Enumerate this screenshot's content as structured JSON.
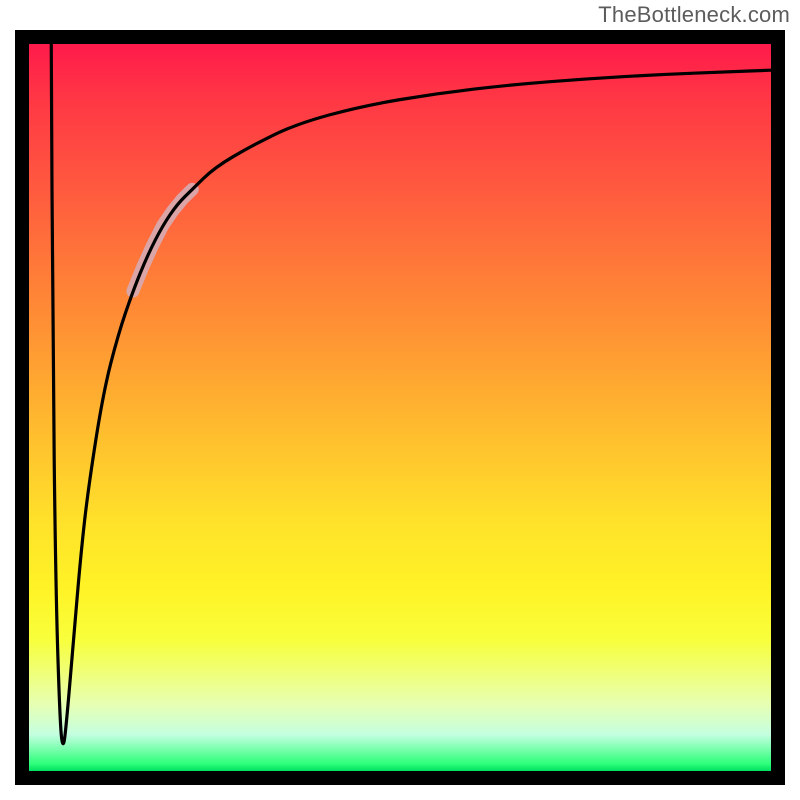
{
  "attribution": "TheBottleneck.com",
  "colors": {
    "frame": "#000000",
    "gradient_top": "#ff1a4b",
    "gradient_bottom": "#00e060",
    "curve": "#000000",
    "highlight": "#d9a8ad"
  },
  "chart_data": {
    "type": "line",
    "title": "",
    "subtitle": "",
    "xlabel": "",
    "ylabel": "",
    "xlim": [
      0,
      100
    ],
    "ylim": [
      0,
      100
    ],
    "grid": false,
    "axes_shown": false,
    "legend": false,
    "background": "vertical-gradient-red-to-green",
    "annotations": [
      {
        "type": "highlight-segment",
        "x_range": [
          14,
          22
        ],
        "style": "thick-light-pink"
      }
    ],
    "series": [
      {
        "name": "curve",
        "description": "Near-vertical drop at low x then rises steeply and asymptotically approaches the top.",
        "x": [
          3.0,
          3.2,
          3.6,
          4.2,
          4.6,
          5.0,
          6.0,
          7.0,
          8.0,
          10.0,
          12.0,
          14.0,
          16.0,
          18.0,
          20.0,
          22.0,
          25.0,
          30.0,
          36.0,
          45.0,
          55.0,
          65.0,
          75.0,
          85.0,
          95.0,
          100.0
        ],
        "values": [
          100,
          60,
          25,
          6,
          3,
          6,
          18,
          30,
          39,
          52,
          60,
          66,
          71,
          75,
          78,
          80,
          83,
          86,
          89,
          91.5,
          93.2,
          94.4,
          95.2,
          95.8,
          96.2,
          96.4
        ]
      }
    ]
  }
}
